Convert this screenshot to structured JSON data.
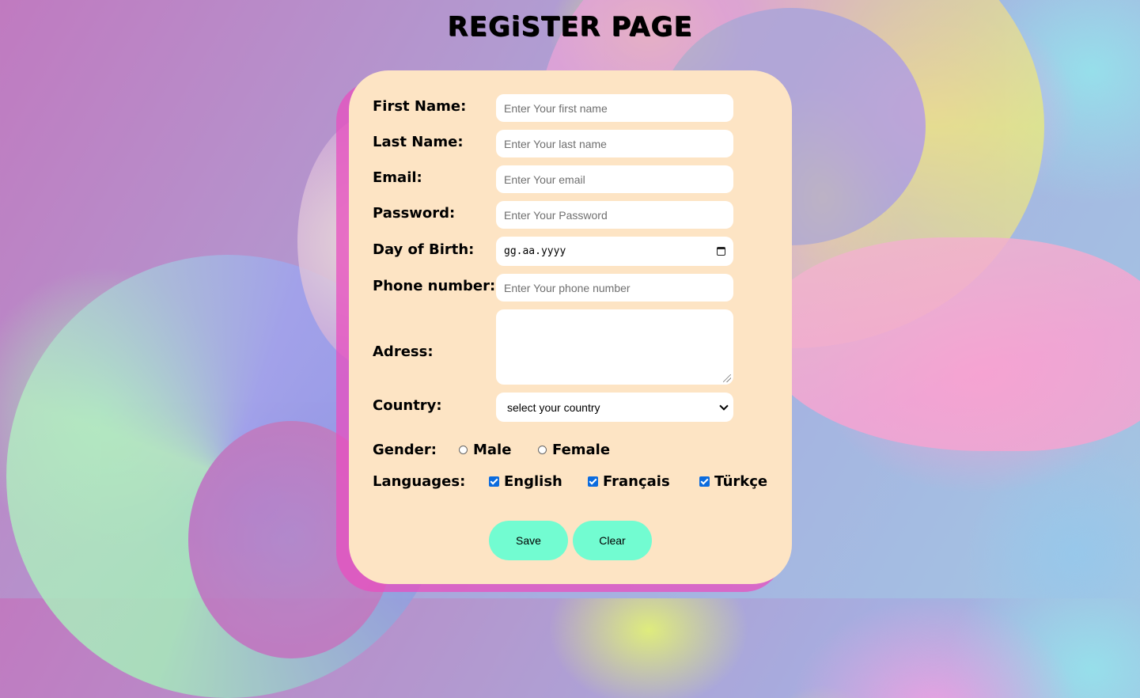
{
  "page_title": "REGiSTER PAGE",
  "form": {
    "first_name": {
      "label": "First Name:",
      "placeholder": "Enter Your first name"
    },
    "last_name": {
      "label": "Last Name:",
      "placeholder": "Enter Your last name"
    },
    "email": {
      "label": "Email:",
      "placeholder": "Enter Your email"
    },
    "password": {
      "label": "Password:",
      "placeholder": "Enter Your Password"
    },
    "birth": {
      "label": "Day of Birth:",
      "value": "gg.aa.yyyy"
    },
    "phone": {
      "label": "Phone number:",
      "placeholder": "Enter Your phone number"
    },
    "address": {
      "label": "Adress:"
    },
    "country": {
      "label": "Country:",
      "value": "select your country"
    },
    "gender": {
      "label": "Gender:",
      "options": [
        "Male",
        "Female"
      ],
      "selected": null
    },
    "languages": {
      "label": "Languages:",
      "options": [
        {
          "name": "English",
          "checked": true
        },
        {
          "name": "Français",
          "checked": true
        },
        {
          "name": "Türkçe",
          "checked": true
        }
      ]
    },
    "buttons": {
      "save": "Save",
      "clear": "Clear"
    }
  },
  "colors": {
    "card": "#fde4c4",
    "card_shadow": "#e84fbf",
    "button": "#72fcd1",
    "checkbox": "#0b6bde"
  }
}
